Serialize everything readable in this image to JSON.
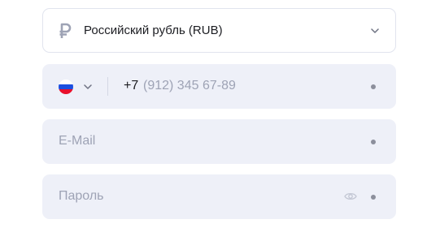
{
  "currency": {
    "icon": "ruble-icon",
    "selected_label": "Российский рубль (RUB)"
  },
  "phone": {
    "country_flag": "russia-flag-icon",
    "prefix": "+7",
    "placeholder": "(912) 345 67-89",
    "value": ""
  },
  "email": {
    "placeholder": "E-Mail",
    "value": ""
  },
  "password": {
    "placeholder": "Пароль",
    "value": "",
    "toggle_icon": "eye-icon"
  },
  "colors": {
    "input_background": "#eef0f8",
    "border": "#e1e4ee",
    "placeholder": "#9ea3b5",
    "text": "#1c1d22",
    "required_marker": "#8c8f9c",
    "flag_white": "#ffffff",
    "flag_blue": "#1b4fe0",
    "flag_red": "#e8102c"
  }
}
